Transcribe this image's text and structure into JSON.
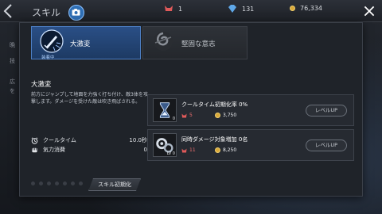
{
  "header": {
    "title": "スキル",
    "resources": [
      {
        "name": "demon-token",
        "value": "1"
      },
      {
        "name": "crystal",
        "value": "131"
      },
      {
        "name": "gold",
        "value": "76,334"
      }
    ]
  },
  "background_text": [
    "晩",
    "技",
    "",
    "広",
    "を"
  ],
  "tabs": [
    {
      "label": "大激変",
      "status": "装着中",
      "active": true
    },
    {
      "label": "堅固な意志",
      "status": "",
      "active": false
    }
  ],
  "skill": {
    "name": "大激変",
    "description": "前方にジャンプして地面を力強く打ち付け、敵3体を攻撃します。ダメージを受けた敵は吹き飛ばされる。",
    "stats": [
      {
        "icon": "alarm-clock-icon",
        "label": "クールタイム",
        "value": "10.0秒"
      },
      {
        "icon": "fist-icon",
        "label": "気力消費",
        "value": "0"
      }
    ],
    "level_dots": 7
  },
  "upgrades": [
    {
      "icon": "hourglass-icon",
      "level": "0",
      "name": "クールタイム初期化率 0%",
      "cost_token": "5",
      "cost_gold": "3,750",
      "button": "レベルUP"
    },
    {
      "icon": "gears-icon",
      "level": "LV 0",
      "name": "同時ダメージ対象増加 0名",
      "cost_token": "11",
      "cost_gold": "8,250",
      "button": "レベルUP"
    }
  ],
  "reset_button": "スキル初期化",
  "colors": {
    "accent": "#2a4f86",
    "gold": "#d9a93a",
    "token": "#e05a5a"
  }
}
